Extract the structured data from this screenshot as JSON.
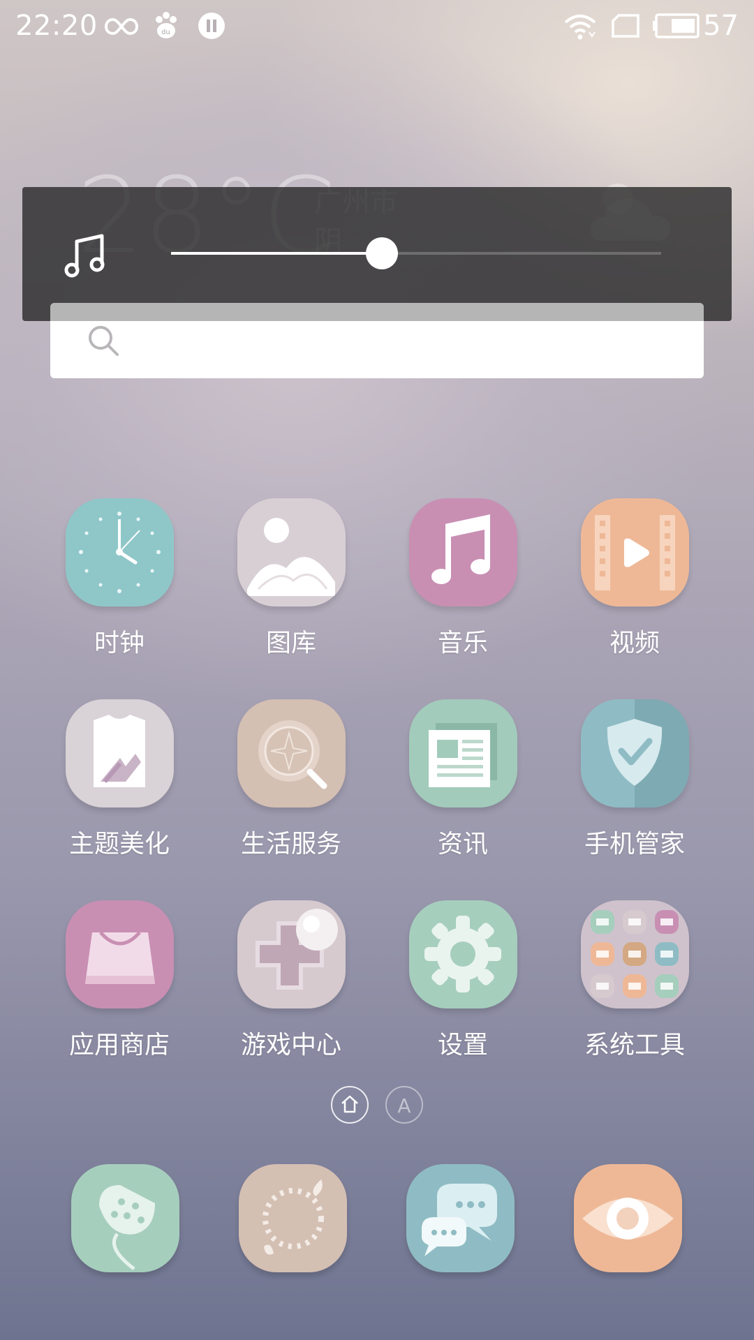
{
  "status_bar": {
    "time": "22:20",
    "icons": [
      "infinity-icon",
      "baidu-paw-icon",
      "pause-icon",
      "wifi-icon",
      "sim-card-icon",
      "battery-icon"
    ],
    "battery": "57"
  },
  "weather": {
    "temperature": "28°C",
    "city": "广州市",
    "condition": "阴",
    "icon": "cloud-icon"
  },
  "volume": {
    "icon": "music-note-icon",
    "level": 0.43
  },
  "search": {
    "placeholder": ""
  },
  "apps": [
    {
      "label": "时钟",
      "icon": "clock-icon",
      "color": "#8fc7c9"
    },
    {
      "label": "图库",
      "icon": "gallery-icon",
      "color": "#d8cfd5"
    },
    {
      "label": "音乐",
      "icon": "music-icon",
      "color": "#c88fb3"
    },
    {
      "label": "视频",
      "icon": "video-icon",
      "color": "#eeb897"
    },
    {
      "label": "主题美化",
      "icon": "theme-icon",
      "color": "#d9d2d6"
    },
    {
      "label": "生活服务",
      "icon": "life-service-icon",
      "color": "#d4bfb3"
    },
    {
      "label": "资讯",
      "icon": "news-icon",
      "color": "#a2cbbb"
    },
    {
      "label": "手机管家",
      "icon": "shield-icon",
      "color": "#8fbcc4"
    },
    {
      "label": "应用商店",
      "icon": "shopping-bag-icon",
      "color": "#c88fb3"
    },
    {
      "label": "游戏中心",
      "icon": "game-icon",
      "color": "#d6cacf"
    },
    {
      "label": "设置",
      "icon": "gear-icon",
      "color": "#a6cebd"
    },
    {
      "label": "系统工具",
      "icon": "folder-icon",
      "color": "#cfc2cc"
    }
  ],
  "pager": {
    "home_icon": "home-icon",
    "letter": "A"
  },
  "dock": [
    {
      "icon": "lotus-icon",
      "color": "#a6cebd"
    },
    {
      "icon": "browser-icon",
      "color": "#d4bfb3"
    },
    {
      "icon": "messages-icon",
      "color": "#8fbcc4"
    },
    {
      "icon": "camera-icon",
      "color": "#eeb897"
    }
  ]
}
